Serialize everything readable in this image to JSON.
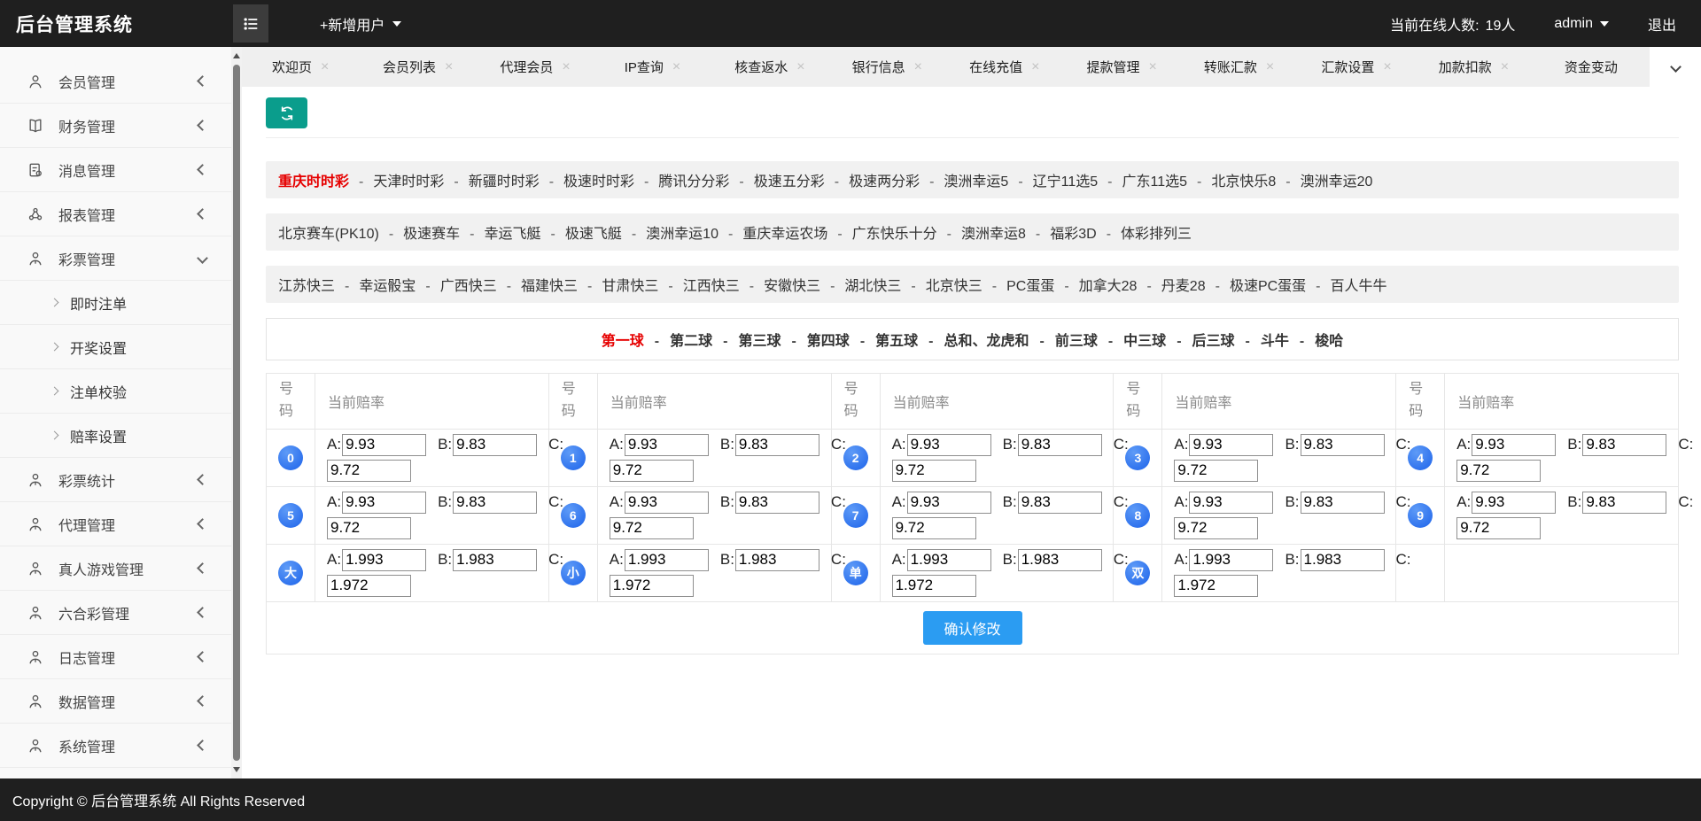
{
  "topbar": {
    "title": "后台管理系统",
    "add_user_label": "+新增用户",
    "online_label": "当前在线人数:",
    "online_count": "19人",
    "username": "admin",
    "logout_label": "退出"
  },
  "sidebar": {
    "items": [
      {
        "icon": "user-icon",
        "label": "会员管理",
        "state": "collapsed"
      },
      {
        "icon": "book-icon",
        "label": "财务管理",
        "state": "collapsed"
      },
      {
        "icon": "file-icon",
        "label": "消息管理",
        "state": "collapsed"
      },
      {
        "icon": "share-icon",
        "label": "报表管理",
        "state": "collapsed"
      },
      {
        "icon": "user-tie-icon",
        "label": "彩票管理",
        "state": "expanded",
        "children": [
          "即时注单",
          "开奖设置",
          "注单校验",
          "赔率设置"
        ]
      },
      {
        "icon": "user-tie-icon",
        "label": "彩票统计",
        "state": "collapsed"
      },
      {
        "icon": "user-tie-icon",
        "label": "代理管理",
        "state": "collapsed"
      },
      {
        "icon": "user-tie-icon",
        "label": "真人游戏管理",
        "state": "collapsed"
      },
      {
        "icon": "user-tie-icon",
        "label": "六合彩管理",
        "state": "collapsed"
      },
      {
        "icon": "user-tie-icon",
        "label": "日志管理",
        "state": "collapsed"
      },
      {
        "icon": "user-tie-icon",
        "label": "数据管理",
        "state": "collapsed"
      },
      {
        "icon": "user-tie-icon",
        "label": "系统管理",
        "state": "collapsed"
      }
    ]
  },
  "tabbar": {
    "tabs": [
      {
        "label": "欢迎页",
        "closable": true
      },
      {
        "label": "会员列表",
        "closable": true
      },
      {
        "label": "代理会员",
        "closable": true
      },
      {
        "label": "IP查询",
        "closable": true
      },
      {
        "label": "核查返水",
        "closable": true
      },
      {
        "label": "银行信息",
        "closable": true
      },
      {
        "label": "在线充值",
        "closable": true
      },
      {
        "label": "提款管理",
        "closable": true
      },
      {
        "label": "转账汇款",
        "closable": true
      },
      {
        "label": "汇款设置",
        "closable": true
      },
      {
        "label": "加款扣款",
        "closable": true
      },
      {
        "label": "资金变动",
        "closable": false
      }
    ]
  },
  "lottery_nav": {
    "separator": "-",
    "rows": [
      {
        "active": "重庆时时彩",
        "links": [
          "重庆时时彩",
          "天津时时彩",
          "新疆时时彩",
          "极速时时彩",
          "腾讯分分彩",
          "极速五分彩",
          "极速两分彩",
          "澳洲幸运5",
          "辽宁11选5",
          "广东11选5",
          "北京快乐8",
          "澳洲幸运20"
        ]
      },
      {
        "active": "",
        "links": [
          "北京赛车(PK10)",
          "极速赛车",
          "幸运飞艇",
          "极速飞艇",
          "澳洲幸运10",
          "重庆幸运农场",
          "广东快乐十分",
          "澳洲幸运8",
          "福彩3D",
          "体彩排列三"
        ]
      },
      {
        "active": "",
        "links": [
          "江苏快三",
          "幸运骰宝",
          "广西快三",
          "福建快三",
          "甘肃快三",
          "江西快三",
          "安徽快三",
          "湖北快三",
          "北京快三",
          "PC蛋蛋",
          "加拿大28",
          "丹麦28",
          "极速PC蛋蛋",
          "百人牛牛"
        ]
      }
    ]
  },
  "position_tabs": {
    "separator": "-",
    "active": "第一球",
    "tabs": [
      "第一球",
      "第二球",
      "第三球",
      "第四球",
      "第五球",
      "总和、龙虎和",
      "前三球",
      "中三球",
      "后三球",
      "斗牛",
      "梭哈"
    ]
  },
  "odds_table": {
    "number_header": "号码",
    "odds_header": "当前赔率",
    "field_labels": [
      "A:",
      "B:",
      "C:"
    ],
    "rows": [
      [
        {
          "badge": "0",
          "values": [
            "9.93",
            "9.83",
            "9.72"
          ]
        },
        {
          "badge": "1",
          "values": [
            "9.93",
            "9.83",
            "9.72"
          ]
        },
        {
          "badge": "2",
          "values": [
            "9.93",
            "9.83",
            "9.72"
          ]
        },
        {
          "badge": "3",
          "values": [
            "9.93",
            "9.83",
            "9.72"
          ]
        },
        {
          "badge": "4",
          "values": [
            "9.93",
            "9.83",
            "9.72"
          ]
        }
      ],
      [
        {
          "badge": "5",
          "values": [
            "9.93",
            "9.83",
            "9.72"
          ]
        },
        {
          "badge": "6",
          "values": [
            "9.93",
            "9.83",
            "9.72"
          ]
        },
        {
          "badge": "7",
          "values": [
            "9.93",
            "9.83",
            "9.72"
          ]
        },
        {
          "badge": "8",
          "values": [
            "9.93",
            "9.83",
            "9.72"
          ]
        },
        {
          "badge": "9",
          "values": [
            "9.93",
            "9.83",
            "9.72"
          ]
        }
      ],
      [
        {
          "badge": "大",
          "values": [
            "1.993",
            "1.983",
            "1.972"
          ]
        },
        {
          "badge": "小",
          "values": [
            "1.993",
            "1.983",
            "1.972"
          ]
        },
        {
          "badge": "单",
          "values": [
            "1.993",
            "1.983",
            "1.972"
          ]
        },
        {
          "badge": "双",
          "values": [
            "1.993",
            "1.983",
            "1.972"
          ]
        },
        null
      ]
    ],
    "confirm_label": "确认修改"
  },
  "footer": {
    "copyright": "Copyright © 后台管理系统 All Rights Reserved"
  },
  "colors": {
    "topbar_bg": "#1f1f1f",
    "refresh_teal": "#0a9d8c",
    "confirm_blue": "#2b9cf2",
    "active_red": "#e60000",
    "badge_blue": "#1d63ea"
  }
}
